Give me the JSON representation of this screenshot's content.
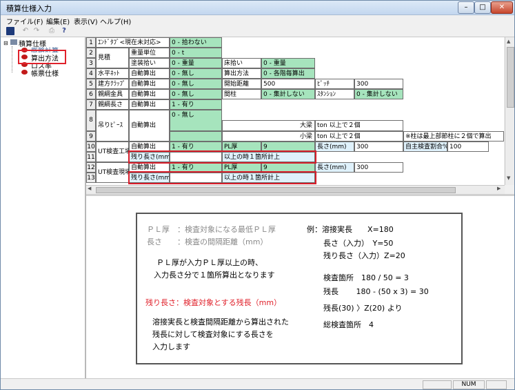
{
  "window": {
    "title": "積算仕様入力"
  },
  "menu": [
    "ファイル(F)",
    "編集(E)",
    "表示(V)",
    "ヘルプ(H)"
  ],
  "toolbar": [
    "save-icon",
    "undo-icon",
    "redo-icon",
    "print-icon",
    "help-icon"
  ],
  "tree": {
    "root": "積算仕様",
    "items": [
      "概略計算",
      "算出方法",
      "ロス率",
      "帳票仕様"
    ]
  },
  "grid": {
    "rows": {
      "r1": [
        "1",
        "ｴﾝﾄﾞﾀﾌﾞ<現在未対応>",
        "0 - 拾わない"
      ],
      "r2": [
        "2",
        "見積",
        "重量単位",
        "0 - t"
      ],
      "r3": [
        "3",
        "塗装拾い",
        "0 - 重量",
        "床拾い",
        "0 - 重量"
      ],
      "r4": [
        "4",
        "水平ﾈｯﾄ",
        "自動算出",
        "0 - 無し",
        "算出方法",
        "0 - 各階毎算出"
      ],
      "r5": [
        "5",
        "建方ｸﾗｯﾌﾟ",
        "自動算出",
        "0 - 無し",
        "開始距離",
        "500",
        "ﾋﾟｯﾁ",
        "300"
      ],
      "r6": [
        "6",
        "親綱金具",
        "自動算出",
        "0 - 無し",
        "間柱",
        "0 - 集計しない",
        "ｽﾀﾝｼｮﾝ",
        "0 - 集計しない"
      ],
      "r7": [
        "7",
        "親綱長さ",
        "自動算出",
        "1 - 有り"
      ],
      "r8": [
        "8",
        "吊りﾋﾟｰｽ",
        "自動算出",
        "0 - 無し",
        "大梁",
        "ton 以上で２個"
      ],
      "r9": [
        "9",
        "小梁",
        "ton 以上で２個",
        "※柱は最上部節柱に２個で算出"
      ],
      "r10": [
        "10",
        "UT検査工場",
        "自動算出",
        "1 - 有り",
        "PL厚",
        "9",
        "長さ(mm)",
        "300",
        "自主検査割合%",
        "100"
      ],
      "r11": [
        "11",
        "残り長さ(mm)",
        "以上の時１箇所計上"
      ],
      "r12": [
        "12",
        "UT検査現場",
        "自動算出",
        "1 - 有り",
        "PL厚",
        "9",
        "長さ(mm)",
        "300"
      ],
      "r13": [
        "13",
        "残り長さ(mm)",
        "以上の時１箇所計上"
      ]
    }
  },
  "note": {
    "l1": "ＰＬ厚　：検査対象になる最低ＰＬ厚",
    "l2": "長さ　　：検査の間隔距離（mm）",
    "l3": "ＰＬ厚が入力ＰＬ厚以上の時、",
    "l4": "入力長さ分で１箇所算出となります",
    "l5": "残り長さ：検査対象とする残長（mm）",
    "l6": "溶接実長と検査間隔距離から算出された",
    "l7": "残長に対して検査対象にする長さを",
    "l8": "入力します",
    "r1": "例：溶接実長　　X=180",
    "r2": "長さ（入力）　Y=50",
    "r3": "残り長さ（入力）Z=20",
    "r4": "検査箇所　180 / 50 = 3",
    "r5": "残長　　 180 - (50 x 3) = 30",
    "r6": "残長(30) 〉Z(20) より",
    "r7": "総検査箇所　4"
  },
  "status": {
    "num": "NUM"
  },
  "colors": {
    "accent_red": "#d81e2b",
    "green_cell": "#a6e4bd",
    "blue_cell": "#dff1fb"
  }
}
